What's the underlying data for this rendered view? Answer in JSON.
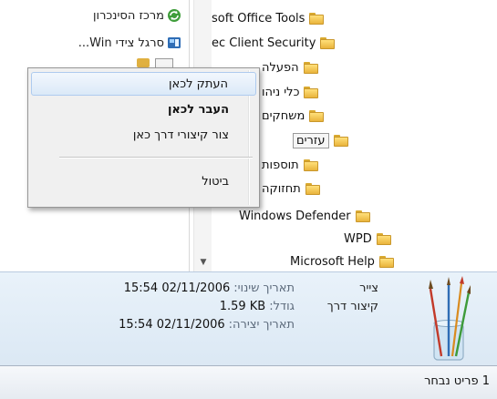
{
  "left_pane": {
    "items": [
      {
        "label": "מרכז הסינכרון",
        "icon": "sync-center-icon"
      },
      {
        "label": "סרגל צידי Win...",
        "icon": "sidebar-app-icon"
      }
    ]
  },
  "context_menu": {
    "items": [
      "העתק לכאן",
      "העבר לכאן",
      "צור קיצורי דרך כאן",
      "ביטול"
    ]
  },
  "folder_list": {
    "items": [
      {
        "name": "soft Office Tools"
      },
      {
        "name": "ec Client Security"
      },
      {
        "name": "הפעלה"
      },
      {
        "name": "כלי ניהו"
      },
      {
        "name": "משחקים"
      },
      {
        "name": "עזרים"
      },
      {
        "name": "תוספות"
      },
      {
        "name": "תחזוקה"
      },
      {
        "name": "Windows Defender"
      },
      {
        "name": "WPD"
      },
      {
        "name": "Microsoft Help"
      }
    ]
  },
  "details": {
    "name": "צייר",
    "type": "קיצור דרך",
    "modified_label": "תאריך שינוי:",
    "modified_value": "15:54 02/11/2006",
    "size_label": "גודל:",
    "size_value": "1.59 KB",
    "created_label": "תאריך יצירה:",
    "created_value": "15:54 02/11/2006"
  },
  "status_bar": {
    "text": "1 פריט נבחר"
  },
  "colors": {
    "folder_yellow": "#f0c24a",
    "details_bg": "#dbe8f4",
    "menu_highlight": "#dbe9f8",
    "menu_bg": "#f0f0f0"
  }
}
